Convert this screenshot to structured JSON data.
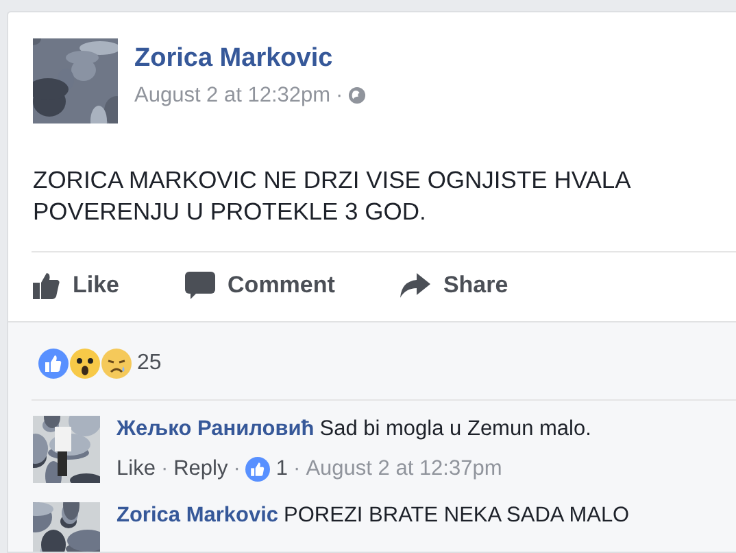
{
  "post": {
    "author": "Zorica Markovic",
    "time": "August 2 at 12:32pm",
    "separator": "·",
    "text_lines": [
      "ZORICA MARKOVIC NE DRZI VISE OGNJISTE HVALA",
      "POVERENJU U PROTEKLE 3 GOD."
    ]
  },
  "actions": [
    {
      "kind": "like",
      "label": "Like"
    },
    {
      "kind": "comment",
      "label": "Comment"
    },
    {
      "kind": "share",
      "label": "Share"
    }
  ],
  "reactions": {
    "count": "25"
  },
  "comments": [
    {
      "author": "Жељко Раниловић",
      "text": "Sad bi mogla u Zemun malo.",
      "links": [
        "Like",
        "Reply"
      ],
      "separator": "·",
      "likes": "1",
      "time": "August 2 at 12:37pm"
    },
    {
      "author": "Zorica Markovic",
      "text": "POREZI BRATE NEKA SADA MALO"
    }
  ]
}
